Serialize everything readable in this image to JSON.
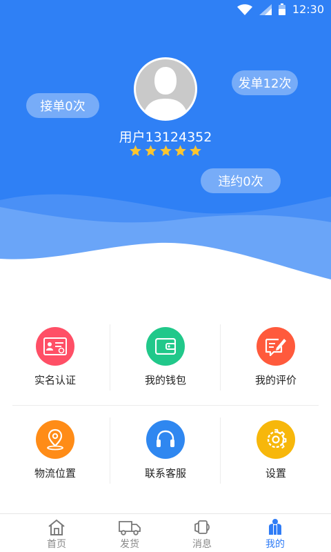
{
  "status_bar": {
    "time": "12:30"
  },
  "profile": {
    "username": "用户13124352",
    "rating_stars": 5,
    "stats": {
      "accept": "接单0次",
      "sent": "发单12次",
      "violate": "违约0次"
    }
  },
  "colors": {
    "header_blue": "#2f80f5",
    "wave_light": "#5b9bf7",
    "star": "#fbc531",
    "tab_active": "#2f7cf6",
    "verify": "#ff4f66",
    "wallet": "#21c88a",
    "review": "#ff5a3c",
    "location": "#ff8c17",
    "service": "#2f87f0",
    "settings": "#f7b70b"
  },
  "menu": {
    "items": [
      {
        "label": "实名认证",
        "icon": "id-card-icon"
      },
      {
        "label": "我的钱包",
        "icon": "wallet-icon"
      },
      {
        "label": "我的评价",
        "icon": "review-edit-icon"
      },
      {
        "label": "物流位置",
        "icon": "location-pin-icon"
      },
      {
        "label": "联系客服",
        "icon": "headset-icon"
      },
      {
        "label": "设置",
        "icon": "gear-icon"
      }
    ]
  },
  "tabs": [
    {
      "label": "首页",
      "icon": "home-icon"
    },
    {
      "label": "发货",
      "icon": "truck-icon"
    },
    {
      "label": "消息",
      "icon": "message-icon"
    },
    {
      "label": "我的",
      "icon": "profile-icon",
      "active": true
    }
  ]
}
